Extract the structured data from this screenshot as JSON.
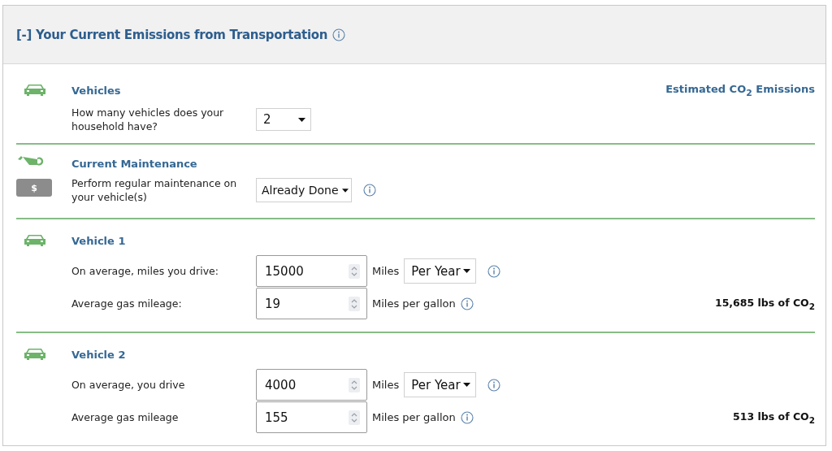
{
  "header": {
    "title": "[-] Your Current Emissions from Transportation"
  },
  "emissions_heading": "Estimated CO$_{2}$ Emissions",
  "sections": [
    {
      "kind": "count",
      "title": "Vehicles",
      "question": "How many vehicles does your household have?",
      "select": "2"
    },
    {
      "kind": "maintenance",
      "title": "Current Maintenance",
      "badge": "$",
      "question": "Perform regular maintenance on your vehicle(s)",
      "select": "Already Done"
    },
    {
      "kind": "vehicle",
      "title": "Vehicle 1",
      "result": "15,685 lbs of CO$_{2}$",
      "rows": [
        {
          "kind": "distance",
          "label": "On average, miles you drive:",
          "value": "15000",
          "unit": "Miles",
          "period": "Per Year"
        },
        {
          "kind": "efficiency",
          "label": "Average gas mileage:",
          "value": "19",
          "unit": "Miles per gallon"
        }
      ]
    },
    {
      "kind": "vehicle",
      "title": "Vehicle 2",
      "result": "513 lbs of CO$_{2}$",
      "rows": [
        {
          "kind": "distance",
          "label": "On average, you drive",
          "value": "4000",
          "unit": "Miles",
          "period": "Per Year"
        },
        {
          "kind": "efficiency",
          "label": "Average gas mileage",
          "value": "155",
          "unit": "Miles per gallon"
        }
      ]
    }
  ]
}
